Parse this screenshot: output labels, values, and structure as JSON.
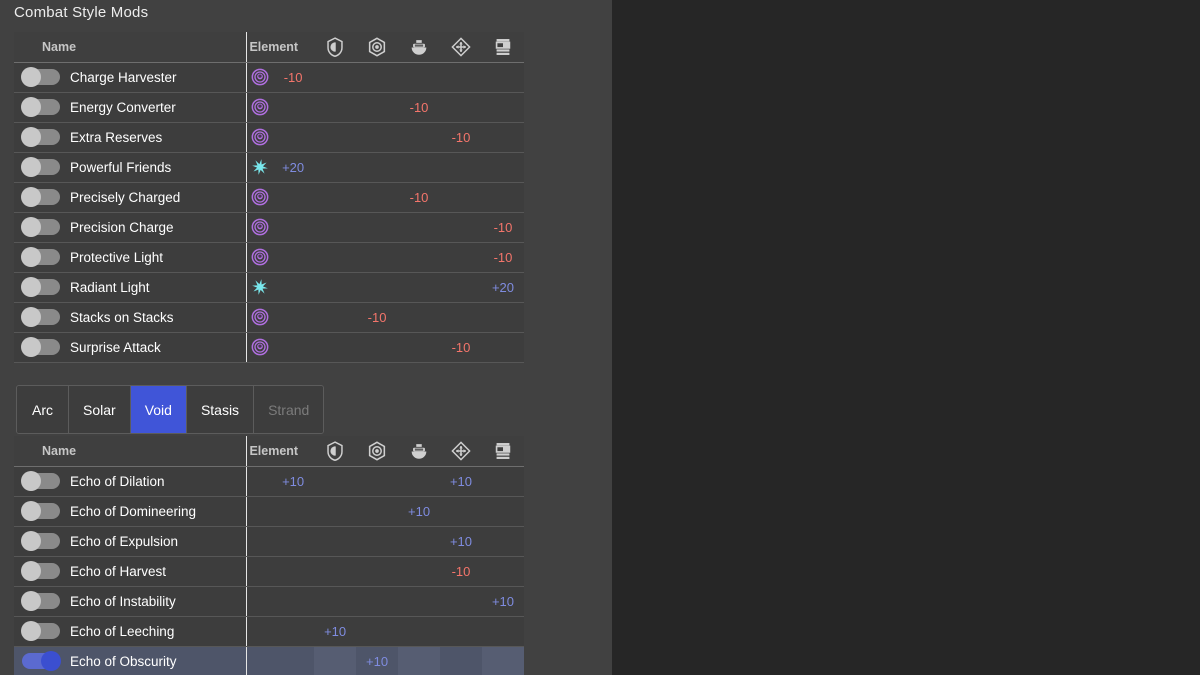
{
  "panel": {
    "title": "Combat Style Mods"
  },
  "stat_columns": [
    {
      "key": "mobility",
      "icon": "mobility-chevrons-icon"
    },
    {
      "key": "resilience",
      "icon": "resilience-shield-icon"
    },
    {
      "key": "recovery",
      "icon": "recovery-hex-icon"
    },
    {
      "key": "discipline",
      "icon": "discipline-grenade-icon"
    },
    {
      "key": "intellect",
      "icon": "intellect-diamond-icon"
    },
    {
      "key": "strength",
      "icon": "strength-melee-icon"
    }
  ],
  "top_table": {
    "headers": {
      "name": "Name",
      "element": "Element"
    },
    "rows": [
      {
        "name": "Charge Harvester",
        "element": "void",
        "enabled": false,
        "stats": [
          "-10",
          "",
          "",
          "",
          "",
          ""
        ]
      },
      {
        "name": "Energy Converter",
        "element": "void",
        "enabled": false,
        "stats": [
          "",
          "",
          "",
          "-10",
          "",
          ""
        ]
      },
      {
        "name": "Extra Reserves",
        "element": "void",
        "enabled": false,
        "stats": [
          "",
          "",
          "",
          "",
          "-10",
          ""
        ]
      },
      {
        "name": "Powerful Friends",
        "element": "arc",
        "enabled": false,
        "stats": [
          "+20",
          "",
          "",
          "",
          "",
          ""
        ]
      },
      {
        "name": "Precisely Charged",
        "element": "void",
        "enabled": false,
        "stats": [
          "",
          "",
          "",
          "-10",
          "",
          ""
        ]
      },
      {
        "name": "Precision Charge",
        "element": "void",
        "enabled": false,
        "stats": [
          "",
          "",
          "",
          "",
          "",
          "-10"
        ]
      },
      {
        "name": "Protective Light",
        "element": "void",
        "enabled": false,
        "stats": [
          "",
          "",
          "",
          "",
          "",
          "-10"
        ]
      },
      {
        "name": "Radiant Light",
        "element": "arc",
        "enabled": false,
        "stats": [
          "",
          "",
          "",
          "",
          "",
          "+20"
        ]
      },
      {
        "name": "Stacks on Stacks",
        "element": "void",
        "enabled": false,
        "stats": [
          "",
          "",
          "-10",
          "",
          "",
          ""
        ]
      },
      {
        "name": "Surprise Attack",
        "element": "void",
        "enabled": false,
        "stats": [
          "",
          "",
          "",
          "",
          "-10",
          ""
        ]
      }
    ]
  },
  "tabs": [
    {
      "label": "Arc",
      "state": "normal"
    },
    {
      "label": "Solar",
      "state": "normal"
    },
    {
      "label": "Void",
      "state": "active"
    },
    {
      "label": "Stasis",
      "state": "normal"
    },
    {
      "label": "Strand",
      "state": "disabled"
    }
  ],
  "bottom_table": {
    "headers": {
      "name": "Name",
      "element": "Element"
    },
    "rows": [
      {
        "name": "Echo of Dilation",
        "element": "",
        "enabled": false,
        "stats": [
          "+10",
          "",
          "",
          "",
          "+10",
          ""
        ]
      },
      {
        "name": "Echo of Domineering",
        "element": "",
        "enabled": false,
        "stats": [
          "",
          "",
          "",
          "+10",
          "",
          ""
        ]
      },
      {
        "name": "Echo of Expulsion",
        "element": "",
        "enabled": false,
        "stats": [
          "",
          "",
          "",
          "",
          "+10",
          ""
        ]
      },
      {
        "name": "Echo of Harvest",
        "element": "",
        "enabled": false,
        "stats": [
          "",
          "",
          "",
          "",
          "-10",
          ""
        ]
      },
      {
        "name": "Echo of Instability",
        "element": "",
        "enabled": false,
        "stats": [
          "",
          "",
          "",
          "",
          "",
          "+10"
        ]
      },
      {
        "name": "Echo of Leeching",
        "element": "",
        "enabled": false,
        "stats": [
          "",
          "+10",
          "",
          "",
          "",
          ""
        ]
      },
      {
        "name": "Echo of Obscurity",
        "element": "",
        "enabled": true,
        "stats": [
          "",
          "",
          "+10",
          "",
          "",
          ""
        ]
      }
    ]
  },
  "colors": {
    "panel_bg": "#414141",
    "page_bg": "#262626",
    "table_bg": "#3d3d3d",
    "positive": "#7f8ce0",
    "negative": "#f4756b",
    "tab_active": "#4055d8",
    "toggle_on": "#3b4fd0",
    "void_element": "#b06fe0",
    "arc_element": "#79e8ed",
    "row_highlight": "#4e5569"
  }
}
